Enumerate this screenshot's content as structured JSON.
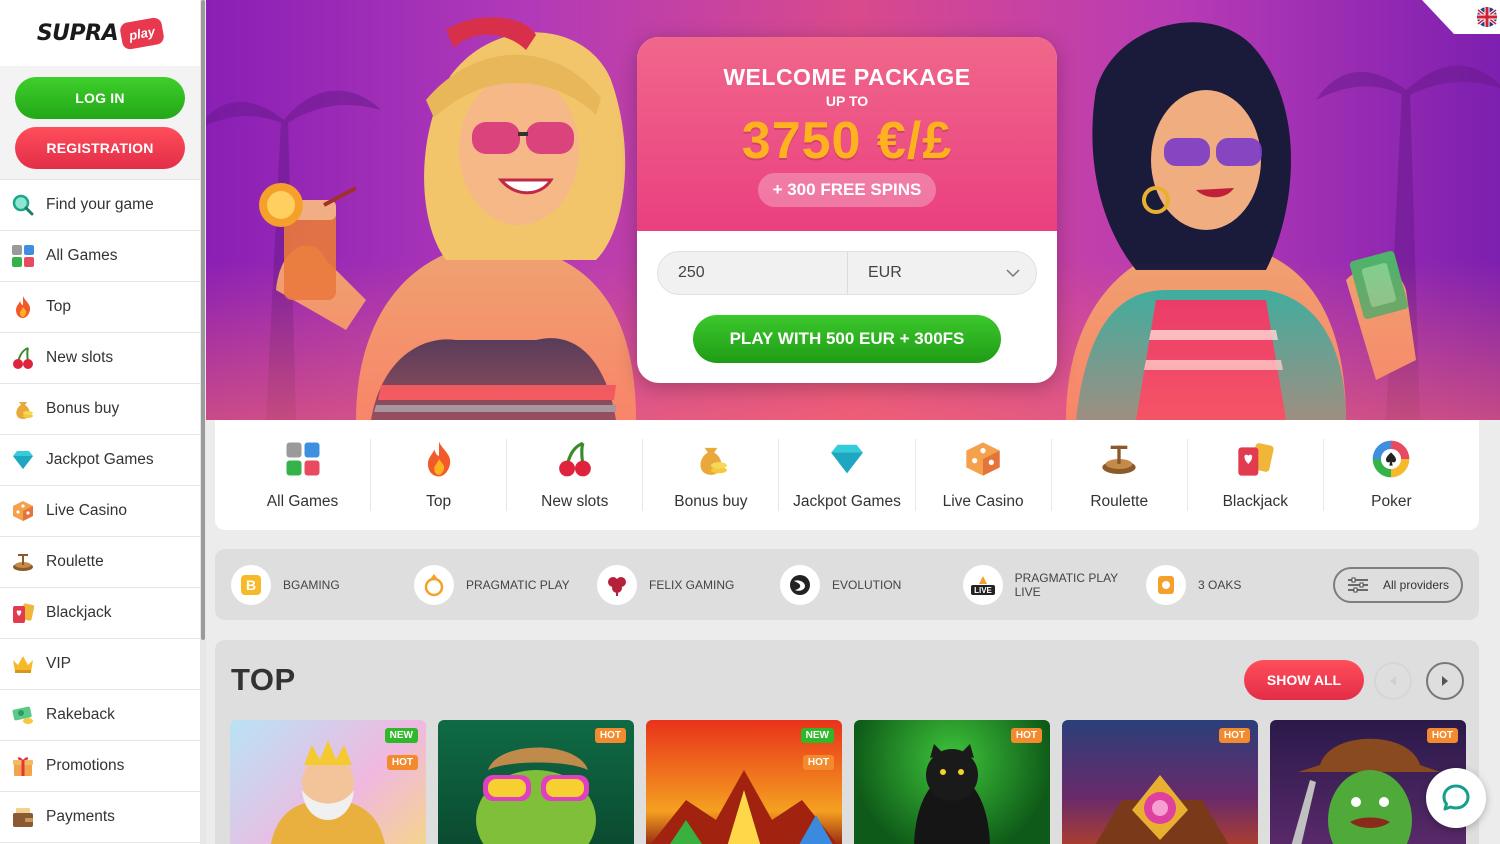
{
  "brand": {
    "name": "SUPRA",
    "badge": "play"
  },
  "auth": {
    "login": "LOG IN",
    "register": "REGISTRATION"
  },
  "sidebar": {
    "items": [
      {
        "label": "Find your game",
        "icon": "search-icon"
      },
      {
        "label": "All Games",
        "icon": "grid-icon"
      },
      {
        "label": "Top",
        "icon": "fire-icon"
      },
      {
        "label": "New slots",
        "icon": "cherries-icon"
      },
      {
        "label": "Bonus buy",
        "icon": "money-bag-icon"
      },
      {
        "label": "Jackpot Games",
        "icon": "diamond-icon"
      },
      {
        "label": "Live Casino",
        "icon": "dice-icon"
      },
      {
        "label": "Roulette",
        "icon": "roulette-icon"
      },
      {
        "label": "Blackjack",
        "icon": "cards-icon"
      },
      {
        "label": "VIP",
        "icon": "crown-icon"
      },
      {
        "label": "Rakeback",
        "icon": "cash-icon"
      },
      {
        "label": "Promotions",
        "icon": "gift-icon"
      },
      {
        "label": "Payments",
        "icon": "wallet-icon"
      }
    ]
  },
  "promo": {
    "title": "WELCOME PACKAGE",
    "subtitle": "UP TO",
    "amount": "3750 €/£",
    "spins": "+ 300 FREE SPINS",
    "deposit_value": "250",
    "currency": "EUR",
    "play_button": "PLAY WITH 500 EUR + 300FS"
  },
  "categories": [
    {
      "label": "All Games",
      "icon": "grid-icon"
    },
    {
      "label": "Top",
      "icon": "fire-icon"
    },
    {
      "label": "New slots",
      "icon": "cherries-icon"
    },
    {
      "label": "Bonus buy",
      "icon": "money-bag-icon"
    },
    {
      "label": "Jackpot Games",
      "icon": "diamond-icon"
    },
    {
      "label": "Live Casino",
      "icon": "dice-icon"
    },
    {
      "label": "Roulette",
      "icon": "roulette-icon"
    },
    {
      "label": "Blackjack",
      "icon": "cards-icon"
    },
    {
      "label": "Poker",
      "icon": "poker-chip-icon"
    }
  ],
  "providers": {
    "items": [
      "BGAMING",
      "PRAGMATIC PLAY",
      "FELIX GAMING",
      "EVOLUTION",
      "PRAGMATIC PLAY LIVE",
      "3 OAKS"
    ],
    "all_button": "All providers"
  },
  "top_section": {
    "title": "TOP",
    "show_all": "SHOW ALL",
    "tiles": [
      {
        "badges": [
          "NEW",
          "HOT"
        ]
      },
      {
        "badges": [
          "HOT"
        ]
      },
      {
        "badges": [
          "NEW",
          "HOT"
        ]
      },
      {
        "badges": [
          "HOT"
        ]
      },
      {
        "badges": [
          "HOT"
        ]
      },
      {
        "badges": [
          "HOT"
        ]
      }
    ]
  },
  "colors": {
    "login_green": "#2bb81f",
    "register_red": "#ef3a4f",
    "promo_pink": "#ea3f80",
    "promo_gold": "#ffb21f",
    "hero_purple": "#8a1fb5"
  }
}
